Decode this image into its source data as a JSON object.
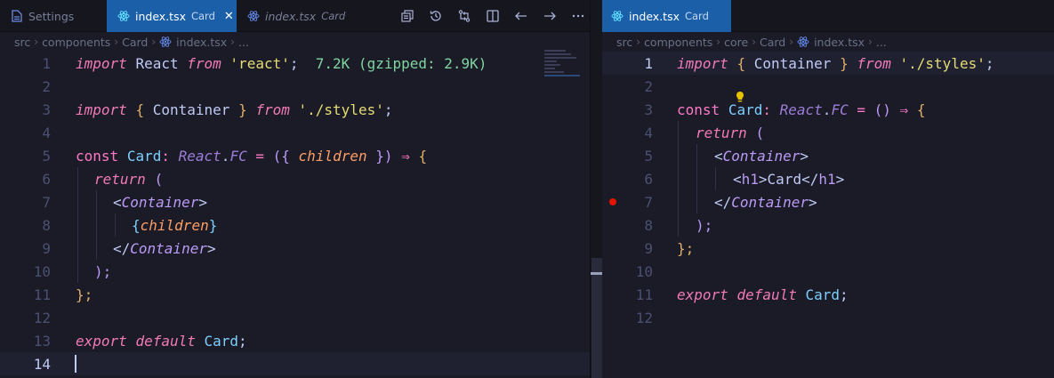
{
  "left": {
    "tabs": [
      {
        "label": "Settings",
        "desc": ""
      },
      {
        "label": "index.tsx",
        "desc": "Card"
      },
      {
        "label": "index.tsx",
        "desc": "Card"
      }
    ],
    "breadcrumb": [
      "src",
      "components",
      "Card",
      "index.tsx",
      "..."
    ],
    "import_size_hint": "7.2K (gzipped: 2.9K)",
    "line_numbers": [
      "1",
      "2",
      "3",
      "4",
      "5",
      "6",
      "7",
      "8",
      "9",
      "10",
      "11",
      "12",
      "13",
      "14"
    ],
    "code": {
      "l1_import": "import",
      "l1_react": "React",
      "l1_from": "from",
      "l1_str": "'react'",
      "l1_semi": ";",
      "l3_import": "import",
      "l3_ob": "{",
      "l3_container": "Container",
      "l3_cb": "}",
      "l3_from": "from",
      "l3_str": "'./styles'",
      "l3_semi": ";",
      "l5_const": "const",
      "l5_card": "Card",
      "l5_colon": ":",
      "l5_react": "React",
      "l5_dot": ".",
      "l5_fc": "FC",
      "l5_eq": "=",
      "l5_op": "(",
      "l5_ob": "{",
      "l5_children": "children",
      "l5_cb": "}",
      "l5_cp": ")",
      "l5_arrow": "⇒",
      "l5_brace": "{",
      "l6_return": "return",
      "l6_paren": "(",
      "l7_lt": "<",
      "l7_tag": "Container",
      "l7_gt": ">",
      "l8_ob": "{",
      "l8_children": "children",
      "l8_cb": "}",
      "l9_lt": "</",
      "l9_tag": "Container",
      "l9_gt": ">",
      "l10_close": ");",
      "l11_close": "};",
      "l13_export": "export",
      "l13_default": "default",
      "l13_card": "Card",
      "l13_semi": ";"
    }
  },
  "right": {
    "tabs": [
      {
        "label": "index.tsx",
        "desc": "Card"
      }
    ],
    "breadcrumb": [
      "src",
      "components",
      "core",
      "Card",
      "index.tsx",
      "..."
    ],
    "line_numbers": [
      "1",
      "2",
      "3",
      "4",
      "5",
      "6",
      "7",
      "8",
      "9",
      "10",
      "11",
      "12"
    ],
    "code": {
      "l1_import": "import",
      "l1_ob": "{",
      "l1_container": "Container",
      "l1_cb": "}",
      "l1_from": "from",
      "l1_str": "'./styles'",
      "l1_semi": ";",
      "l3_const": "const",
      "l3_card": "Card",
      "l3_colon": ":",
      "l3_react": "React",
      "l3_dot": ".",
      "l3_fc": "FC",
      "l3_eq": "=",
      "l3_parens": "()",
      "l3_arrow": "⇒",
      "l3_brace": "{",
      "l4_return": "return",
      "l4_paren": "(",
      "l5_lt": "<",
      "l5_tag": "Container",
      "l5_gt": ">",
      "l6_lt": "<",
      "l6_h1": "h1",
      "l6_gt": ">",
      "l6_text": "Card",
      "l6_lt2": "</",
      "l6_h1b": "h1",
      "l6_gt2": ">",
      "l7_lt": "</",
      "l7_tag": "Container",
      "l7_gt": ">",
      "l8_close": ");",
      "l9_close": "};",
      "l11_export": "export",
      "l11_default": "default",
      "l11_card": "Card",
      "l11_semi": ";"
    }
  },
  "icons": {
    "settings_tab": "file-settings-icon",
    "react_file": "react-icon",
    "open_changes": "open-changes-icon",
    "timeline": "history-icon",
    "compare": "compare-icon",
    "split": "split-editor-icon",
    "back": "arrow-left-icon",
    "forward": "arrow-right-icon",
    "more": "more-actions-icon",
    "lightbulb": "lightbulb-icon",
    "breakpoint": "breakpoint-icon"
  },
  "colors": {
    "background": "#1a1b26",
    "tab_active": "#1a5fa8",
    "keyword": "#bb9af7",
    "type": "#7dcfff",
    "string": "#e6db74",
    "breakpoint": "#e51400"
  }
}
